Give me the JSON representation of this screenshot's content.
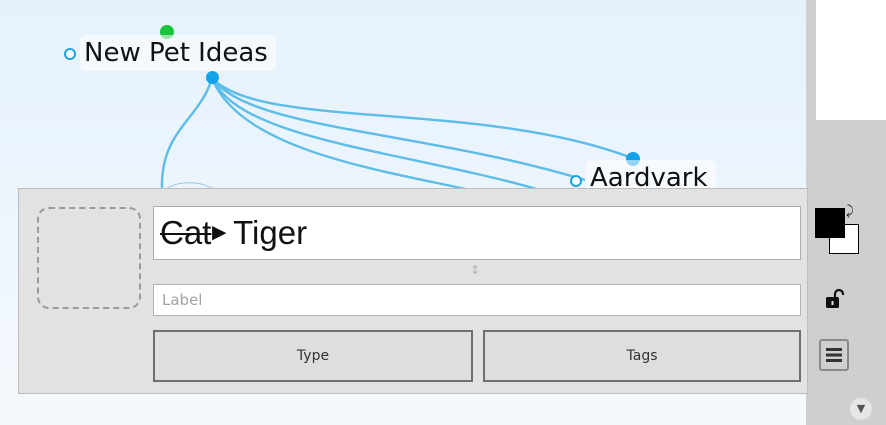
{
  "map": {
    "root_node": {
      "label": "New Pet Ideas"
    },
    "child_nodes": [
      {
        "label": "Aardvark"
      }
    ],
    "edge_color": "#5bbde8",
    "connector_color": "#12a3ea",
    "drag_handle_color": "#18c43c"
  },
  "editor": {
    "title": {
      "strikethrough_text": "Cat",
      "arrow": "►",
      "new_text": "Tiger"
    },
    "label_placeholder": "Label",
    "label_value": "",
    "type_button": "Type",
    "tags_button": "Tags",
    "resize_handle": "↕"
  },
  "side_panel": {
    "scroll_arrow": "▼"
  },
  "icons": {
    "color_swatch": "color-swatch-icon",
    "swap": "swap-arrow-icon",
    "lock": "unlock-icon",
    "menu": "hamburger-menu-icon",
    "image_placeholder": "image-placeholder"
  },
  "colors": {
    "foreground_color": "#000000",
    "background_color": "#ffffff"
  }
}
